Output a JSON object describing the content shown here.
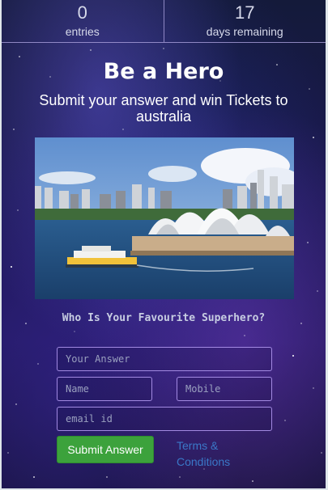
{
  "stats": [
    {
      "value": "0",
      "label": "entries"
    },
    {
      "value": "17",
      "label": "days remaining"
    }
  ],
  "headline": "Be a Hero",
  "subheadline": "Submit your answer and win Tickets to australia",
  "image": {
    "subject": "sydney-opera-house"
  },
  "question": "Who Is Your Favourite Superhero?",
  "form": {
    "answer_placeholder": "Your Answer",
    "name_placeholder": "Name",
    "mobile_placeholder": "Mobile",
    "email_placeholder": "email id",
    "submit_label": "Submit Answer",
    "terms_label": "Terms & Conditions"
  },
  "colors": {
    "submit": "#3ca23c",
    "link": "#3a78c8",
    "field_border": "#af96f0"
  }
}
